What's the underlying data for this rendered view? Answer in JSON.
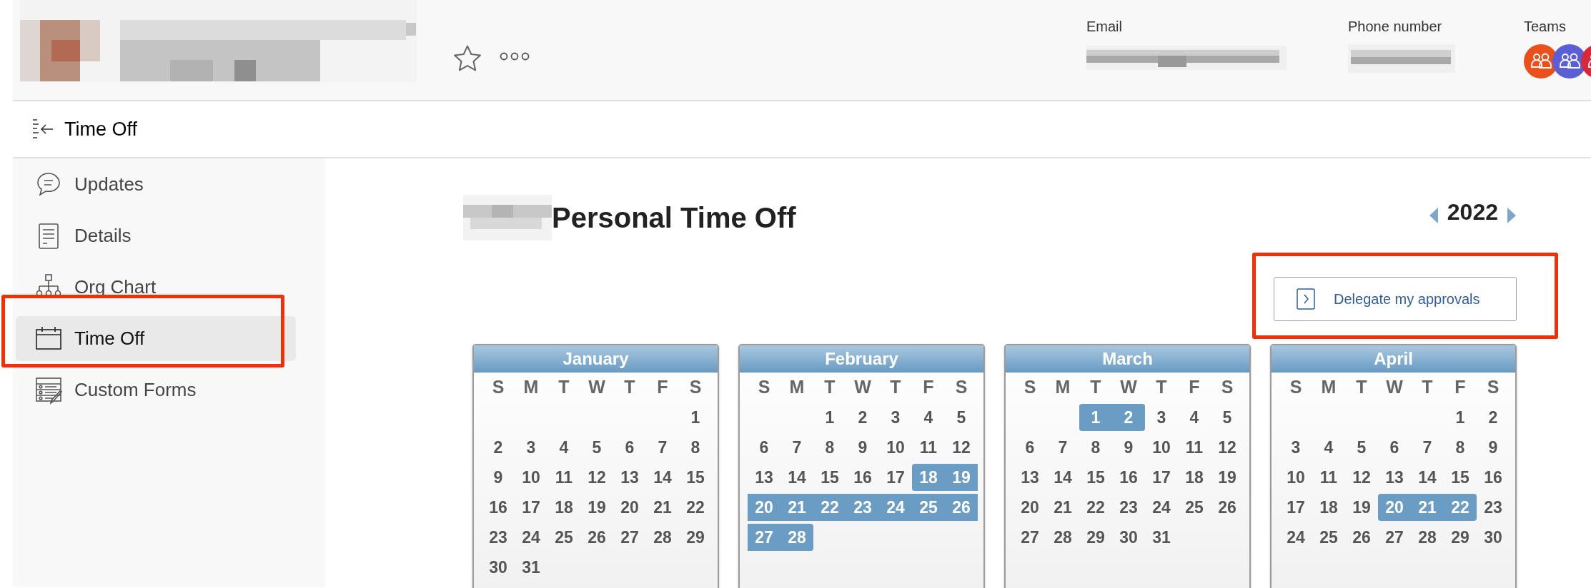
{
  "header": {
    "email_label": "Email",
    "phone_label": "Phone number",
    "teams_label": "Teams",
    "teams": [
      {
        "color": "#e8501c"
      },
      {
        "color": "#5b5fd6"
      },
      {
        "color": "#d8283c"
      }
    ]
  },
  "page_title": "Time Off",
  "sidebar": {
    "items": [
      {
        "label": "Updates",
        "selected": false
      },
      {
        "label": "Details",
        "selected": false
      },
      {
        "label": "Org Chart",
        "selected": false
      },
      {
        "label": "Time Off",
        "selected": true
      },
      {
        "label": "Custom Forms",
        "selected": false
      }
    ]
  },
  "main": {
    "title": "Personal Time Off",
    "year": "2022",
    "delegate_button": "Delegate my approvals",
    "months": [
      {
        "name": "January",
        "weekdays": [
          "S",
          "M",
          "T",
          "W",
          "T",
          "F",
          "S"
        ],
        "weeks": [
          {
            "kind": "start",
            "days": [
              {
                "day": "1",
                "selected": false
              }
            ]
          },
          {
            "kind": "week",
            "days": [
              {
                "day": "2",
                "selected": false
              },
              {
                "day": "3",
                "selected": false
              },
              {
                "day": "4",
                "selected": false
              },
              {
                "day": "5",
                "selected": false
              },
              {
                "day": "6",
                "selected": false
              },
              {
                "day": "7",
                "selected": false
              },
              {
                "day": "8",
                "selected": false
              }
            ]
          },
          {
            "kind": "week",
            "days": [
              {
                "day": "9",
                "selected": false
              },
              {
                "day": "10",
                "selected": false
              },
              {
                "day": "11",
                "selected": false
              },
              {
                "day": "12",
                "selected": false
              },
              {
                "day": "13",
                "selected": false
              },
              {
                "day": "14",
                "selected": false
              },
              {
                "day": "15",
                "selected": false
              }
            ]
          },
          {
            "kind": "week",
            "days": [
              {
                "day": "16",
                "selected": false
              },
              {
                "day": "17",
                "selected": false
              },
              {
                "day": "18",
                "selected": false
              },
              {
                "day": "19",
                "selected": false
              },
              {
                "day": "20",
                "selected": false
              },
              {
                "day": "21",
                "selected": false
              },
              {
                "day": "22",
                "selected": false
              }
            ]
          },
          {
            "kind": "week",
            "days": [
              {
                "day": "23",
                "selected": false
              },
              {
                "day": "24",
                "selected": false
              },
              {
                "day": "25",
                "selected": false
              },
              {
                "day": "26",
                "selected": false
              },
              {
                "day": "27",
                "selected": false
              },
              {
                "day": "28",
                "selected": false
              },
              {
                "day": "29",
                "selected": false
              }
            ]
          },
          {
            "kind": "week",
            "days": [
              {
                "day": "30",
                "selected": false
              },
              {
                "day": "31",
                "selected": false
              }
            ]
          }
        ]
      },
      {
        "name": "February",
        "weekdays": [
          "S",
          "M",
          "T",
          "W",
          "T",
          "F",
          "S"
        ],
        "weeks": [
          {
            "kind": "start",
            "days": [
              {
                "day": "1",
                "selected": false
              },
              {
                "day": "2",
                "selected": false
              },
              {
                "day": "3",
                "selected": false
              },
              {
                "day": "4",
                "selected": false
              },
              {
                "day": "5",
                "selected": false
              }
            ]
          },
          {
            "kind": "week",
            "days": [
              {
                "day": "6",
                "selected": false
              },
              {
                "day": "7",
                "selected": false
              },
              {
                "day": "8",
                "selected": false
              },
              {
                "day": "9",
                "selected": false
              },
              {
                "day": "10",
                "selected": false
              },
              {
                "day": "11",
                "selected": false
              },
              {
                "day": "12",
                "selected": false
              }
            ]
          },
          {
            "kind": "week",
            "days": [
              {
                "day": "13",
                "selected": false
              },
              {
                "day": "14",
                "selected": false
              },
              {
                "day": "15",
                "selected": false
              },
              {
                "day": "16",
                "selected": false
              },
              {
                "day": "17",
                "selected": false
              },
              {
                "day": "18",
                "selected": true
              },
              {
                "day": "19",
                "selected": true
              }
            ]
          },
          {
            "kind": "week",
            "days": [
              {
                "day": "20",
                "selected": true
              },
              {
                "day": "21",
                "selected": true
              },
              {
                "day": "22",
                "selected": true
              },
              {
                "day": "23",
                "selected": true
              },
              {
                "day": "24",
                "selected": true
              },
              {
                "day": "25",
                "selected": true
              },
              {
                "day": "26",
                "selected": true
              }
            ]
          },
          {
            "kind": "week",
            "days": [
              {
                "day": "27",
                "selected": true
              },
              {
                "day": "28",
                "selected": true
              }
            ]
          }
        ]
      },
      {
        "name": "March",
        "weekdays": [
          "S",
          "M",
          "T",
          "W",
          "T",
          "F",
          "S"
        ],
        "weeks": [
          {
            "kind": "start",
            "days": [
              {
                "day": "1",
                "selected": true
              },
              {
                "day": "2",
                "selected": true
              },
              {
                "day": "3",
                "selected": false
              },
              {
                "day": "4",
                "selected": false
              },
              {
                "day": "5",
                "selected": false
              }
            ]
          },
          {
            "kind": "week",
            "days": [
              {
                "day": "6",
                "selected": false
              },
              {
                "day": "7",
                "selected": false
              },
              {
                "day": "8",
                "selected": false
              },
              {
                "day": "9",
                "selected": false
              },
              {
                "day": "10",
                "selected": false
              },
              {
                "day": "11",
                "selected": false
              },
              {
                "day": "12",
                "selected": false
              }
            ]
          },
          {
            "kind": "week",
            "days": [
              {
                "day": "13",
                "selected": false
              },
              {
                "day": "14",
                "selected": false
              },
              {
                "day": "15",
                "selected": false
              },
              {
                "day": "16",
                "selected": false
              },
              {
                "day": "17",
                "selected": false
              },
              {
                "day": "18",
                "selected": false
              },
              {
                "day": "19",
                "selected": false
              }
            ]
          },
          {
            "kind": "week",
            "days": [
              {
                "day": "20",
                "selected": false
              },
              {
                "day": "21",
                "selected": false
              },
              {
                "day": "22",
                "selected": false
              },
              {
                "day": "23",
                "selected": false
              },
              {
                "day": "24",
                "selected": false
              },
              {
                "day": "25",
                "selected": false
              },
              {
                "day": "26",
                "selected": false
              }
            ]
          },
          {
            "kind": "week",
            "days": [
              {
                "day": "27",
                "selected": false
              },
              {
                "day": "28",
                "selected": false
              },
              {
                "day": "29",
                "selected": false
              },
              {
                "day": "30",
                "selected": false
              },
              {
                "day": "31",
                "selected": false
              }
            ]
          }
        ]
      },
      {
        "name": "April",
        "weekdays": [
          "S",
          "M",
          "T",
          "W",
          "T",
          "F",
          "S"
        ],
        "weeks": [
          {
            "kind": "start",
            "days": [
              {
                "day": "1",
                "selected": false
              },
              {
                "day": "2",
                "selected": false
              }
            ]
          },
          {
            "kind": "week",
            "days": [
              {
                "day": "3",
                "selected": false
              },
              {
                "day": "4",
                "selected": false
              },
              {
                "day": "5",
                "selected": false
              },
              {
                "day": "6",
                "selected": false
              },
              {
                "day": "7",
                "selected": false
              },
              {
                "day": "8",
                "selected": false
              },
              {
                "day": "9",
                "selected": false
              }
            ]
          },
          {
            "kind": "week",
            "days": [
              {
                "day": "10",
                "selected": false
              },
              {
                "day": "11",
                "selected": false
              },
              {
                "day": "12",
                "selected": false
              },
              {
                "day": "13",
                "selected": false
              },
              {
                "day": "14",
                "selected": false
              },
              {
                "day": "15",
                "selected": false
              },
              {
                "day": "16",
                "selected": false
              }
            ]
          },
          {
            "kind": "week",
            "days": [
              {
                "day": "17",
                "selected": false
              },
              {
                "day": "18",
                "selected": false
              },
              {
                "day": "19",
                "selected": false
              },
              {
                "day": "20",
                "selected": true
              },
              {
                "day": "21",
                "selected": true
              },
              {
                "day": "22",
                "selected": true
              },
              {
                "day": "23",
                "selected": false
              }
            ]
          },
          {
            "kind": "week",
            "days": [
              {
                "day": "24",
                "selected": false
              },
              {
                "day": "25",
                "selected": false
              },
              {
                "day": "26",
                "selected": false
              },
              {
                "day": "27",
                "selected": false
              },
              {
                "day": "28",
                "selected": false
              },
              {
                "day": "29",
                "selected": false
              },
              {
                "day": "30",
                "selected": false
              }
            ]
          }
        ]
      }
    ]
  }
}
